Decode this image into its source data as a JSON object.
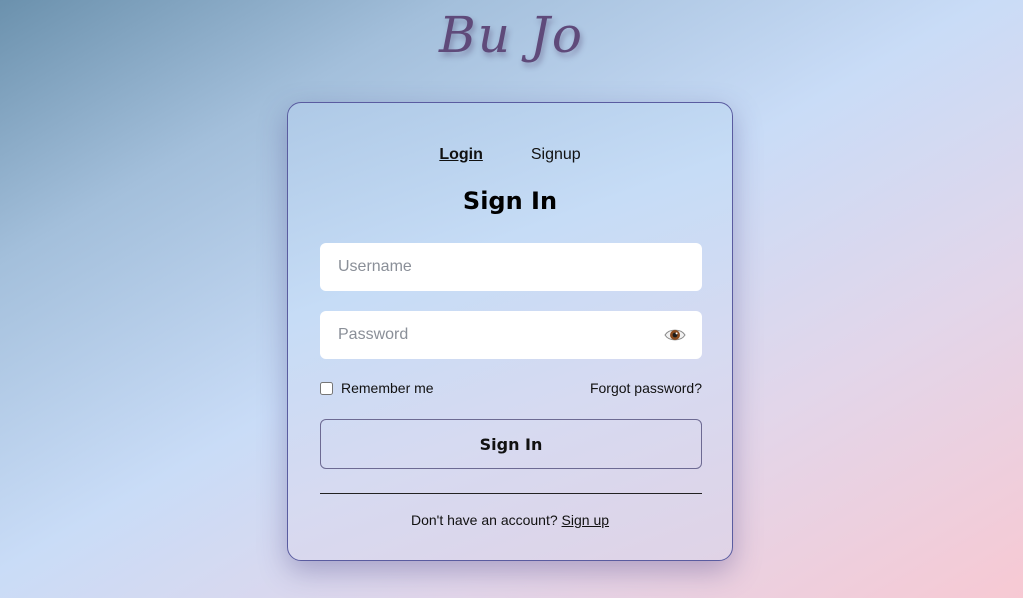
{
  "brand": {
    "logo_text": "Bu Jo"
  },
  "tabs": [
    {
      "label": "Login",
      "active": true
    },
    {
      "label": "Signup",
      "active": false
    }
  ],
  "form": {
    "title": "Sign In",
    "username": {
      "placeholder": "Username",
      "value": ""
    },
    "password": {
      "placeholder": "Password",
      "value": "",
      "toggle_icon": "eye-icon"
    },
    "remember_label": "Remember me",
    "remember_checked": false,
    "forgot_label": "Forgot password?",
    "submit_label": "Sign In",
    "footer_text": "Don't have an account?",
    "footer_link": "Sign up"
  },
  "colors": {
    "logo": "#5f4a7a",
    "card_border": "#5a5ca0",
    "background_start": "#6b91ad",
    "background_end": "#f7c9d3"
  }
}
